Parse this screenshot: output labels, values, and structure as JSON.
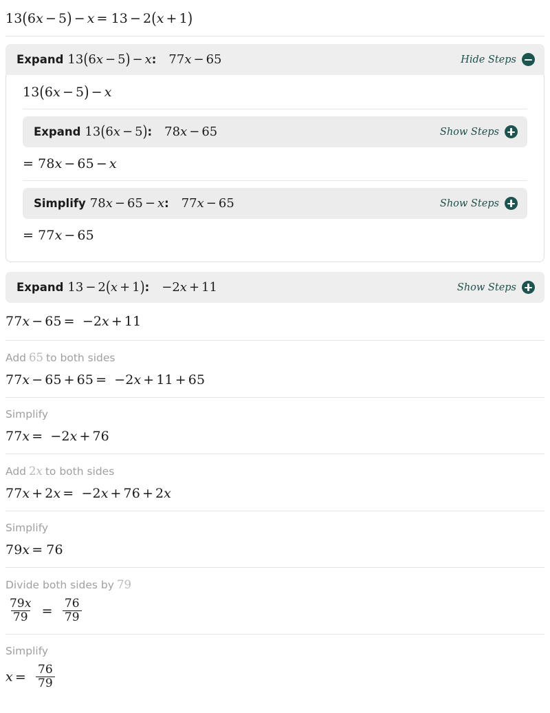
{
  "problem": {
    "equation": "13(6x-5)-x=13-2(x+1)"
  },
  "colors": {
    "accent": "#1d5450",
    "bar_bg": "#eeeeee",
    "caption_gray": "#a0a0a0",
    "divider": "#e3e3e3"
  },
  "toggles": {
    "hide_label": "Hide Steps",
    "show_label": "Show Steps",
    "minus_icon": "minus-circle-icon",
    "plus_icon": "plus-circle-icon"
  },
  "expand_left": {
    "lead": "Expand",
    "expression": "13(6x-5)-x",
    "colon": ":",
    "result": "77x-65",
    "toggle_label": "Hide Steps",
    "state": "expanded",
    "body": {
      "opening_expression": "13(6x-5)-x",
      "sub_steps": [
        {
          "lead": "Expand",
          "expression": "13(6x-5)",
          "colon": ":",
          "result": "78x-65",
          "toggle_label": "Show Steps",
          "state": "collapsed",
          "following_line": "=78x-65-x"
        },
        {
          "lead": "Simplify",
          "expression": "78x-65-x",
          "colon": ":",
          "result": "77x-65",
          "toggle_label": "Show Steps",
          "state": "collapsed",
          "following_line": "=77x-65"
        }
      ]
    }
  },
  "expand_right": {
    "lead": "Expand",
    "expression": "13-2(x+1)",
    "colon": ":",
    "result": "-2x+11",
    "toggle_label": "Show Steps",
    "state": "collapsed"
  },
  "solution": {
    "main_equation": "77x-65=-2x+11",
    "steps": [
      {
        "caption_before": "Add",
        "caption_math": "65",
        "caption_after": "to both sides",
        "equation": "77x-65+65=-2x+11+65"
      },
      {
        "caption_before": "Simplify",
        "caption_math": "",
        "caption_after": "",
        "equation": "77x=-2x+76"
      },
      {
        "caption_before": "Add",
        "caption_math": "2x",
        "caption_after": "to both sides",
        "equation": "77x+2x=-2x+76+2x"
      },
      {
        "caption_before": "Simplify",
        "caption_math": "",
        "caption_after": "",
        "equation": "79x=76"
      },
      {
        "caption_before": "Divide both sides by",
        "caption_math": "79",
        "caption_after": "",
        "equation": "79x/79 = 76/79",
        "fraction": {
          "left_num": "79x",
          "left_den": "79",
          "right_num": "76",
          "right_den": "79"
        }
      },
      {
        "caption_before": "Simplify",
        "caption_math": "",
        "caption_after": "",
        "equation": "x = 76/79",
        "fraction": {
          "right_num": "76",
          "right_den": "79"
        }
      }
    ]
  }
}
